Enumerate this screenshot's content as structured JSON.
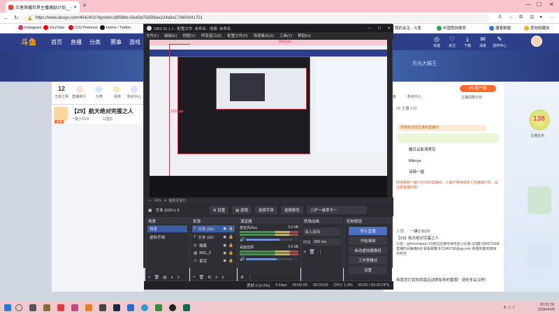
{
  "browser": {
    "tab_title": "王者荣耀世界主播激励计划__一键...",
    "new_tab": "+",
    "url": "https://www.douyu.com/4042402?dyshid=16f59bb-c5e63d7585fbae224a9e173600041701",
    "bookmarks": [
      {
        "label": "Instagram",
        "color": "#e1306c"
      },
      {
        "label": "YouTube",
        "color": "#ff0000"
      },
      {
        "label": "(13) Pinterest",
        "color": "#e60023"
      },
      {
        "label": "Home / Twitter",
        "color": "#111111"
      },
      {
        "label": "我的关注 - 斗鱼",
        "color": "#ff7a00"
      },
      {
        "label": "中国竞技服务",
        "color": "#2da34c"
      },
      {
        "label": "播客数据",
        "color": "#3a76d8"
      },
      {
        "label": "其他收藏夹",
        "color": "#f0b429"
      }
    ]
  },
  "douyu": {
    "logo": "斗鱼",
    "nav": [
      "首页",
      "直播",
      "分类",
      "赛事",
      "游戏"
    ],
    "header_right": [
      "充值",
      "关注",
      "下载",
      "消息",
      "创作中心"
    ],
    "banner_text": "月光大猫王·",
    "left_info": {
      "level": "12",
      "level_label": "王者之师",
      "items": [
        "直播排行",
        "分类",
        "贵族",
        "粉丝中心"
      ]
    },
    "right_info": {
      "items": [
        "钓鱼",
        "粉丝中心"
      ],
      "button": "PC客户端",
      "sub": "主播招聘计划"
    },
    "room": {
      "title": "【29】航天绝对完蛋之人",
      "badge": "主播",
      "sub1": "一键小伙29",
      "sub2": "三国志"
    },
    "chat": {
      "header": "29 主播 123",
      "gift_banner": "周榜粉丝团主播的直播间",
      "rows": [
        "暖日云影清莲花",
        "Mikoya",
        "诗简一眉"
      ],
      "announce": "欢迎来到一键小伙29的直播间，斗鱼严禁未成年人直播或打赏，请注意直播内容。",
      "host_name": "主播",
      "host_line": "一键小伙29",
      "notice": "【29】航天绝对完蛋之人",
      "extra": "公告：ps5/ns/steam 21级拉拉牌可得可爱小头像 QQ群 600072368 直播时间每晚8点 联系邮箱 872240798@qq.com 希望你能欢度快乐时光",
      "last": "恭喜您打赏你西南远动牌有你的蕾蕾！请你多关注吧！"
    },
    "side": {
      "badge": "138",
      "sub": "主播任务"
    }
  },
  "obs": {
    "title": "OBS 31.1.1 - 配置文件: 未命名 - 场景: 未命名",
    "menu": [
      "文件(F)",
      "编辑(E)",
      "视图(V)",
      "停靠窗口(D)",
      "配置文件(P)",
      "场景集合(S)",
      "工具(T)",
      "帮助(H)"
    ],
    "preview_label_w": "1616 px",
    "preview_label_h": "1036 px",
    "zoom": "41%",
    "zoom_label": "缩放至窗口",
    "source_name": "文本 (GDI+) 3",
    "source_buttons": [
      "设置",
      "滤镜",
      "选择字体",
      "选择颜色",
      "二护一缘率不一"
    ],
    "docks": {
      "scenes": {
        "title": "场景",
        "items": [
          "场景",
          "虚拟手柄"
        ]
      },
      "sources": {
        "title": "来源",
        "items": [
          "文本 (GD",
          "文本 (GD",
          "弹幕",
          "IMG_3",
          "麦克"
        ]
      },
      "mixer": {
        "title": "混音器",
        "tracks": [
          {
            "name": "麦克风/Aux",
            "db": "0.0 dB",
            "level": 0.72
          },
          {
            "name": "桌面音频",
            "db": "0.0 dB",
            "level": 0.66
          }
        ]
      },
      "transitions": {
        "title": "转场动画",
        "type": "淡入淡出",
        "duration_label": "时长",
        "duration": "300 ms"
      },
      "controls": {
        "title": "控制按钮",
        "buttons": [
          "停止直播",
          "开始录制",
          "启动虚拟摄像机",
          "工作室模式",
          "设置"
        ]
      }
    },
    "status": {
      "dropped": "丢帧 0 (0.0%)",
      "bitrate": "0 kbps",
      "stream_time": "00:00:00",
      "rec_time": "00:00:00",
      "cpu": "CPU: 1.0%",
      "fps": "60.00 / 60.00 FPS"
    }
  },
  "taskbar": {
    "time": "20:51:31",
    "date": "2026/4/26"
  }
}
